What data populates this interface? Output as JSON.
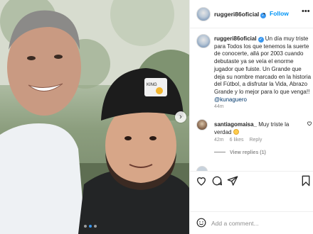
{
  "post": {
    "username": "ruggeri86oficial",
    "verified_mark": "✓",
    "separator": "•",
    "follow_label": "Follow",
    "more_label": "•••",
    "slide_next": "›",
    "carousel": {
      "count": 3,
      "active_index": 1
    }
  },
  "caption": {
    "username": "ruggeri86oficial",
    "text": " Un día muy triste para Todos los que tenemos la suerte de conocerte, allá por 2003 cuando debutaste ya se veía el enorme jugador que fuiste. Un Grande que deja su nombre marcado en la historia del Fútbol, a disfrutar la Vida, Abrazo Grande y lo mejor para lo que venga!! ",
    "mention": "@kunaguero",
    "time": "44m"
  },
  "comment": {
    "username": "santiagomaisa_",
    "text": " Muy triste la verdad ",
    "time": "42m",
    "likes": "6 likes",
    "reply_label": "Reply",
    "view_replies": "View replies (1)"
  },
  "composer": {
    "placeholder": "Add a comment..."
  },
  "icons": [
    "heart-icon",
    "comment-icon",
    "share-icon",
    "bookmark-icon",
    "emoji-icon"
  ]
}
